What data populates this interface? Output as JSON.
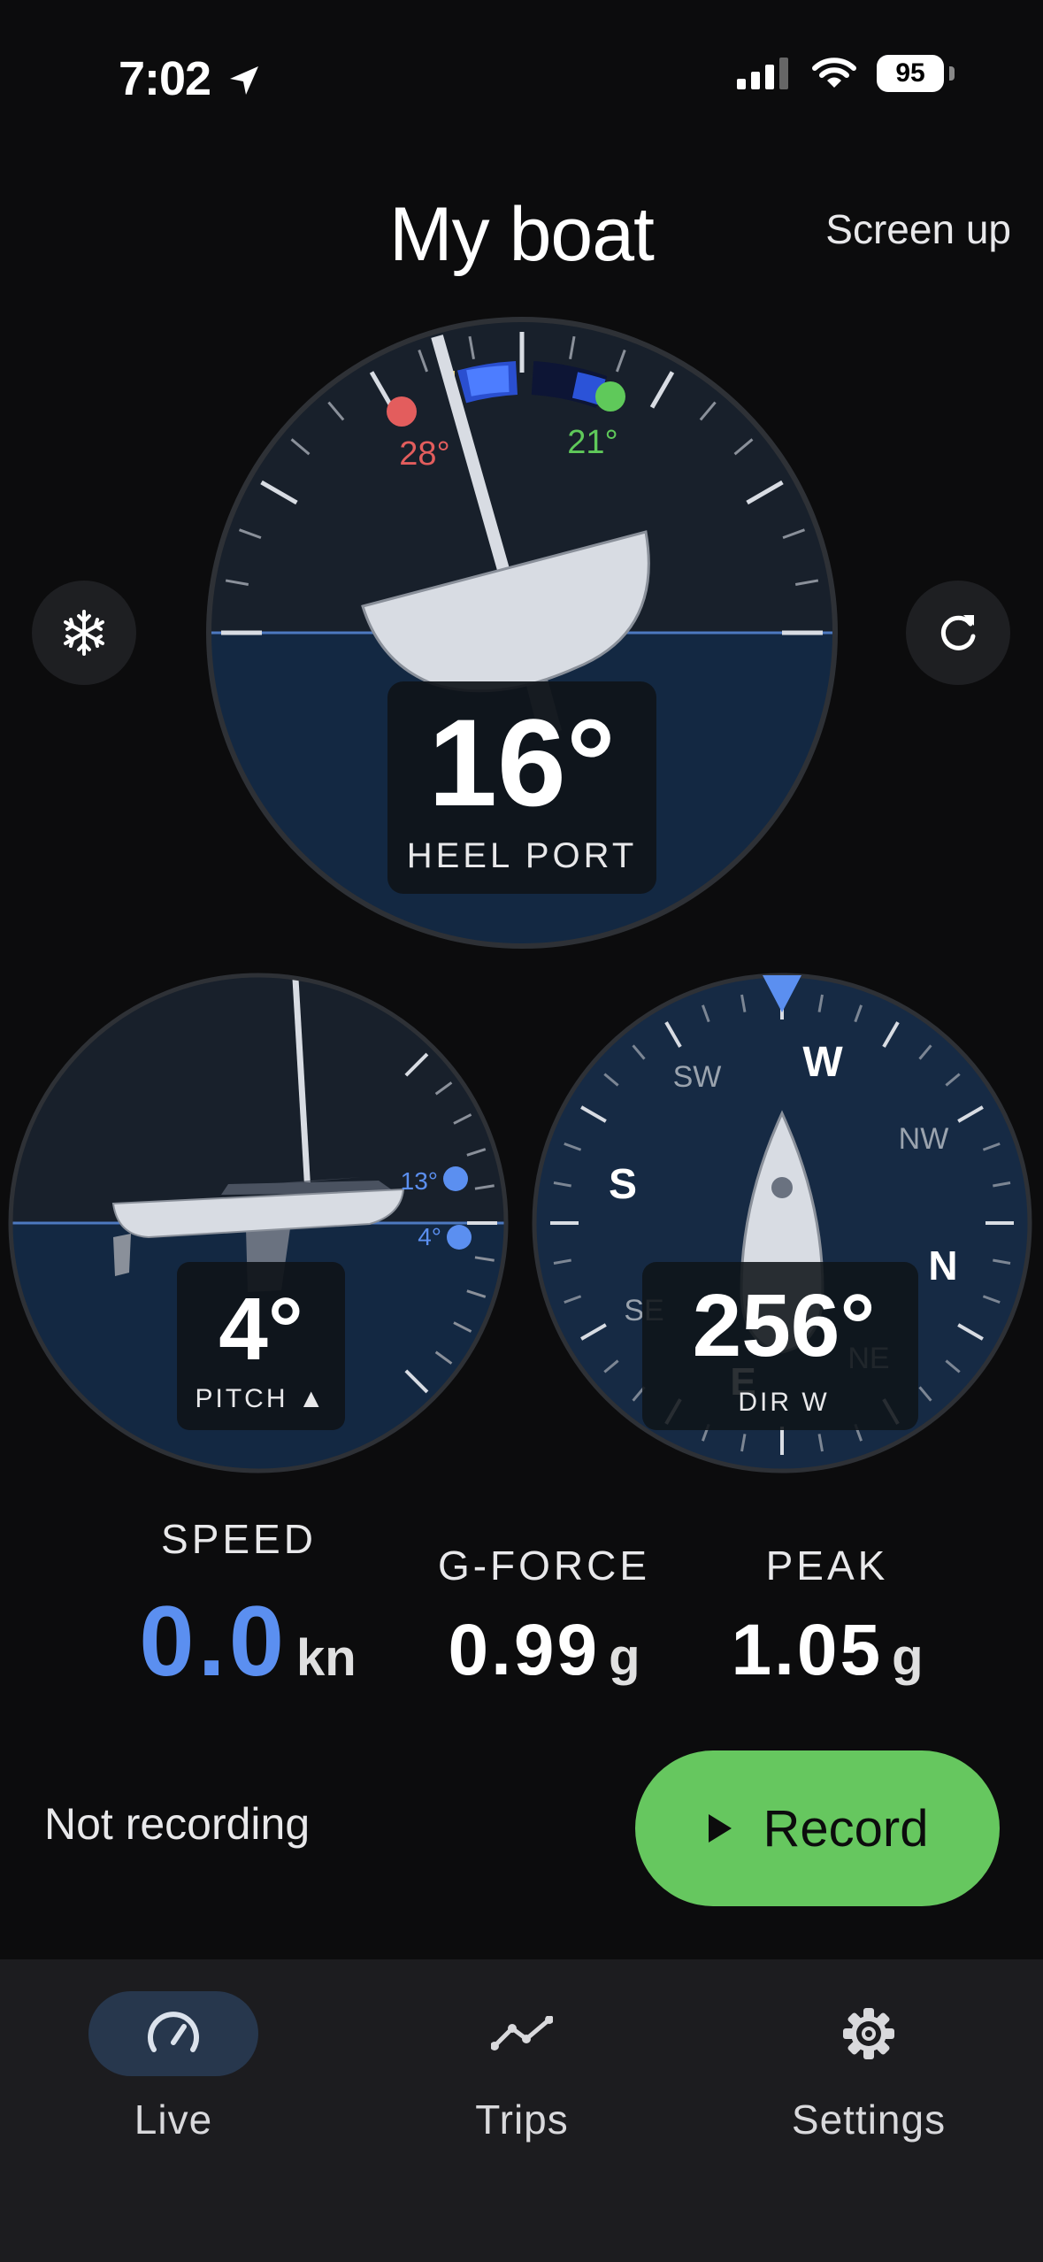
{
  "status_bar": {
    "time": "7:02",
    "battery": "95"
  },
  "header": {
    "title": "My boat",
    "screen_up": "Screen up"
  },
  "heel_gauge": {
    "value": "16°",
    "label": "HEEL PORT",
    "max_port": "28°",
    "max_starboard": "21°"
  },
  "pitch_gauge": {
    "value": "4°",
    "label": "PITCH ▲",
    "marker_high": "13°",
    "marker_low": "4°"
  },
  "compass": {
    "value": "256°",
    "label": "DIR W",
    "cardinals": {
      "w": "W",
      "s": "S",
      "n": "N",
      "e": "E"
    },
    "intercardinals": {
      "sw": "SW",
      "nw": "NW",
      "se": "SE",
      "ne": "NE"
    }
  },
  "stats": {
    "speed": {
      "label": "SPEED",
      "value": "0.0",
      "unit": "kn"
    },
    "gforce": {
      "label": "G-FORCE",
      "value": "0.99",
      "unit": "g"
    },
    "peak": {
      "label": "PEAK",
      "value": "1.05",
      "unit": "g"
    }
  },
  "recording": {
    "status": "Not recording",
    "button": "Record"
  },
  "tabs": [
    {
      "label": "Live",
      "icon": "gauge-icon",
      "active": true
    },
    {
      "label": "Trips",
      "icon": "trend-icon",
      "active": false
    },
    {
      "label": "Settings",
      "icon": "gear-icon",
      "active": false
    }
  ],
  "colors": {
    "accent_blue": "#5b8ff0",
    "record_green": "#66c75f",
    "port_red": "#e35d5d",
    "starboard_green": "#5fc95a",
    "sky": "#18202b",
    "water": "#132842"
  }
}
